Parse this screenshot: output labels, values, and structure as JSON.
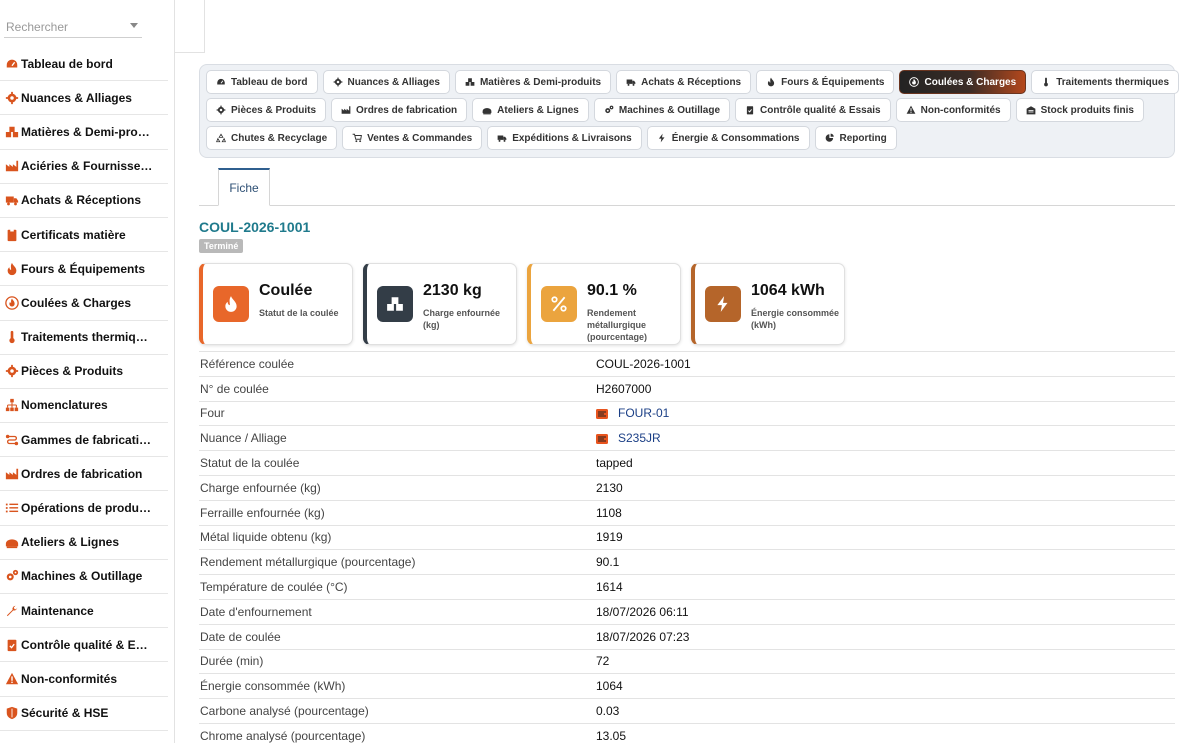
{
  "sidebar": {
    "search_placeholder": "Rechercher",
    "items": [
      {
        "label": "Tableau de bord",
        "icon": "speedometer-icon"
      },
      {
        "label": "Nuances & Alliages",
        "icon": "cog-icon"
      },
      {
        "label": "Matières & Demi-pro…",
        "icon": "cubes-icon"
      },
      {
        "label": "Aciéries & Fournisse…",
        "icon": "factory-icon"
      },
      {
        "label": "Achats & Réceptions",
        "icon": "truck-icon"
      },
      {
        "label": "Certificats matière",
        "icon": "clipboard-icon"
      },
      {
        "label": "Fours & Équipements",
        "icon": "fire-icon"
      },
      {
        "label": "Coulées & Charges",
        "icon": "fire-circle-icon"
      },
      {
        "label": "Traitements thermiq…",
        "icon": "thermometer-icon"
      },
      {
        "label": "Pièces & Produits",
        "icon": "cog-icon"
      },
      {
        "label": "Nomenclatures",
        "icon": "sitemap-icon"
      },
      {
        "label": "Gammes de fabricati…",
        "icon": "route-icon"
      },
      {
        "label": "Ordres de fabrication",
        "icon": "factory-icon"
      },
      {
        "label": "Opérations de produ…",
        "icon": "list-icon"
      },
      {
        "label": "Ateliers & Lignes",
        "icon": "workshop-icon"
      },
      {
        "label": "Machines & Outillage",
        "icon": "cogs-icon"
      },
      {
        "label": "Maintenance",
        "icon": "wrench-icon"
      },
      {
        "label": "Contrôle qualité & E…",
        "icon": "clipboard-check-icon"
      },
      {
        "label": "Non-conformités",
        "icon": "warning-icon"
      },
      {
        "label": "Sécurité & HSE",
        "icon": "shield-icon"
      }
    ]
  },
  "nav": {
    "rows": [
      [
        {
          "label": "Tableau de bord",
          "icon": "speedometer-icon",
          "active": false
        },
        {
          "label": "Nuances & Alliages",
          "icon": "cog-icon",
          "active": false
        },
        {
          "label": "Matières & Demi-produits",
          "icon": "cubes-icon",
          "active": false
        },
        {
          "label": "Achats & Réceptions",
          "icon": "truck-icon",
          "active": false
        },
        {
          "label": "Fours & Équipements",
          "icon": "fire-icon",
          "active": false
        },
        {
          "label": "Coulées & Charges",
          "icon": "fire-circle-icon",
          "active": true
        },
        {
          "label": "Traitements thermiques",
          "icon": "thermometer-icon",
          "active": false
        }
      ],
      [
        {
          "label": "Pièces & Produits",
          "icon": "cog-icon",
          "active": false
        },
        {
          "label": "Ordres de fabrication",
          "icon": "factory-icon",
          "active": false
        },
        {
          "label": "Ateliers & Lignes",
          "icon": "workshop-icon",
          "active": false
        },
        {
          "label": "Machines & Outillage",
          "icon": "cogs-icon",
          "active": false
        },
        {
          "label": "Contrôle qualité & Essais",
          "icon": "clipboard-check-icon",
          "active": false
        },
        {
          "label": "Non-conformités",
          "icon": "warning-icon",
          "active": false
        },
        {
          "label": "Stock produits finis",
          "icon": "warehouse-icon",
          "active": false
        }
      ],
      [
        {
          "label": "Chutes & Recyclage",
          "icon": "recycle-icon",
          "active": false
        },
        {
          "label": "Ventes & Commandes",
          "icon": "cart-icon",
          "active": false
        },
        {
          "label": "Expéditions & Livraisons",
          "icon": "truck-icon",
          "active": false
        },
        {
          "label": "Énergie & Consommations",
          "icon": "bolt-icon",
          "active": false
        },
        {
          "label": "Reporting",
          "icon": "pie-chart-icon",
          "active": false
        }
      ]
    ]
  },
  "tabs": {
    "fiche": "Fiche"
  },
  "record": {
    "title": "COUL-2026-1001",
    "status_badge": "Terminé"
  },
  "kpis": [
    {
      "value": "Coulée",
      "label": "Statut de la coulée",
      "icon": "fire-icon",
      "color": "#e8672a",
      "border": "#e8672a"
    },
    {
      "value": "2130 kg",
      "label": "Charge enfournée (kg)",
      "icon": "cubes-icon",
      "color": "#333d47",
      "border": "#333d47"
    },
    {
      "value": "90.1 %",
      "label": "Rendement métallurgique (pourcentage)",
      "icon": "percent-icon",
      "color": "#eba43e",
      "border": "#eba43e"
    },
    {
      "value": "1064 kWh",
      "label": "Énergie consommée (kWh)",
      "icon": "bolt-icon",
      "color": "#b5652a",
      "border": "#b5652a"
    }
  ],
  "fields": [
    {
      "label": "Référence coulée",
      "value": "COUL-2026-1001",
      "link": false
    },
    {
      "label": "N° de coulée",
      "value": "H2607000",
      "link": false
    },
    {
      "label": "Four",
      "value": "FOUR-01",
      "link": true
    },
    {
      "label": "Nuance / Alliage",
      "value": "S235JR",
      "link": true
    },
    {
      "label": "Statut de la coulée",
      "value": "tapped",
      "link": false
    },
    {
      "label": "Charge enfournée (kg)",
      "value": "2130",
      "link": false
    },
    {
      "label": "Ferraille enfournée (kg)",
      "value": "1108",
      "link": false
    },
    {
      "label": "Métal liquide obtenu (kg)",
      "value": "1919",
      "link": false
    },
    {
      "label": "Rendement métallurgique (pourcentage)",
      "value": "90.1",
      "link": false
    },
    {
      "label": "Température de coulée (°C)",
      "value": "1614",
      "link": false
    },
    {
      "label": "Date d'enfournement",
      "value": "18/07/2026 06:11",
      "link": false
    },
    {
      "label": "Date de coulée",
      "value": "18/07/2026 07:23",
      "link": false
    },
    {
      "label": "Durée (min)",
      "value": "72",
      "link": false
    },
    {
      "label": "Énergie consommée (kWh)",
      "value": "1064",
      "link": false
    },
    {
      "label": "Carbone analysé (pourcentage)",
      "value": "0.03",
      "link": false
    },
    {
      "label": "Chrome analysé (pourcentage)",
      "value": "13.05",
      "link": false
    }
  ],
  "colors": {
    "accent": "#d9541e",
    "title": "#1f7a8c",
    "link": "#1b3f86"
  }
}
